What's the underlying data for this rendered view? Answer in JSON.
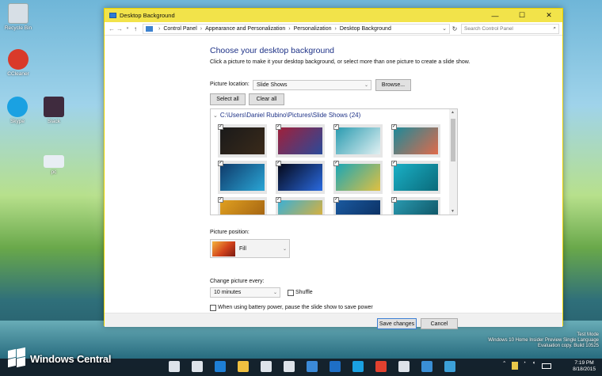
{
  "desktop": {
    "icons": [
      {
        "label": "Recycle Bin",
        "color": "#d7dfe6"
      },
      {
        "label": "CCleaner",
        "color": "#d93a2a"
      },
      {
        "label": "Skype",
        "color": "#1aa1e2"
      },
      {
        "label": "Slack",
        "color": "#3f2b3e"
      },
      {
        "label": "pc",
        "color": "#e8eef4"
      }
    ],
    "watermark": {
      "line1": "Test Mode",
      "line2": "Windows 10 Home Insider Preview Single Language",
      "line3": "Evaluation copy. Build 10525"
    },
    "brand": "Windows Central"
  },
  "window": {
    "title": "Desktop Background",
    "controls": {
      "minimize": "—",
      "maximize": "☐",
      "close": "✕"
    },
    "breadcrumb": [
      "Control Panel",
      "Appearance and Personalization",
      "Personalization",
      "Desktop Background"
    ],
    "search_placeholder": "Search Control Panel"
  },
  "main": {
    "heading": "Choose your desktop background",
    "description": "Click a picture to make it your desktop background, or select more than one picture to create a slide show.",
    "picture_location_label": "Picture location:",
    "picture_location_value": "Slide Shows",
    "browse_label": "Browse...",
    "select_all_label": "Select all",
    "clear_all_label": "Clear all",
    "folder_label": "C:\\Users\\Daniel Rubino\\Pictures\\Slide Shows (24)",
    "thumbnails": [
      {
        "colors": [
          "#1a1a1a",
          "#3a2a1a"
        ],
        "checked": true
      },
      {
        "colors": [
          "#a0203a",
          "#2a4a9a"
        ],
        "checked": true
      },
      {
        "colors": [
          "#2a9bb0",
          "#e0f0f2"
        ],
        "checked": true
      },
      {
        "colors": [
          "#1c8a9a",
          "#e06a4a"
        ],
        "checked": true
      },
      {
        "colors": [
          "#0f3a6a",
          "#2aa6d6"
        ],
        "checked": true
      },
      {
        "colors": [
          "#050818",
          "#2a6ae0"
        ],
        "checked": true
      },
      {
        "colors": [
          "#1aa6b6",
          "#e0c040"
        ],
        "checked": true
      },
      {
        "colors": [
          "#1ab0c6",
          "#0a6a7a"
        ],
        "checked": true
      },
      {
        "colors": [
          "#e0a020",
          "#9a5a10"
        ],
        "checked": true
      },
      {
        "colors": [
          "#3ab0d6",
          "#f6b020"
        ],
        "checked": true
      },
      {
        "colors": [
          "#1a5aa0",
          "#0a2a5a"
        ],
        "checked": true
      },
      {
        "colors": [
          "#2a9ab0",
          "#0a4a5a"
        ],
        "checked": true
      }
    ],
    "picture_position_label": "Picture position:",
    "picture_position_value": "Fill",
    "change_picture_label": "Change picture every:",
    "interval_value": "10 minutes",
    "shuffle_label": "Shuffle",
    "battery_label": "When using battery power, pause the slide show to save power"
  },
  "footer": {
    "save_label": "Save changes",
    "cancel_label": "Cancel"
  },
  "taskbar": {
    "time": "7:19 PM",
    "date": "8/18/2015",
    "apps": [
      {
        "name": "mic-icon",
        "color": "#dde3ea"
      },
      {
        "name": "task-view-icon",
        "color": "#dde3ea"
      },
      {
        "name": "edge-icon",
        "color": "#1e7fd6"
      },
      {
        "name": "file-explorer-icon",
        "color": "#f0c040"
      },
      {
        "name": "store-icon",
        "color": "#dde3ea"
      },
      {
        "name": "mail-icon",
        "color": "#dde3ea"
      },
      {
        "name": "photos-icon",
        "color": "#3b8ad8"
      },
      {
        "name": "calendar-icon",
        "color": "#1e6fc6"
      },
      {
        "name": "skype-icon",
        "color": "#1aa1e2"
      },
      {
        "name": "chrome-icon",
        "color": "#e2412f"
      },
      {
        "name": "settings-icon",
        "color": "#dde3ea"
      },
      {
        "name": "weather-icon",
        "color": "#3a8fd6"
      },
      {
        "name": "control-panel-icon",
        "color": "#3ca0d8"
      }
    ]
  }
}
